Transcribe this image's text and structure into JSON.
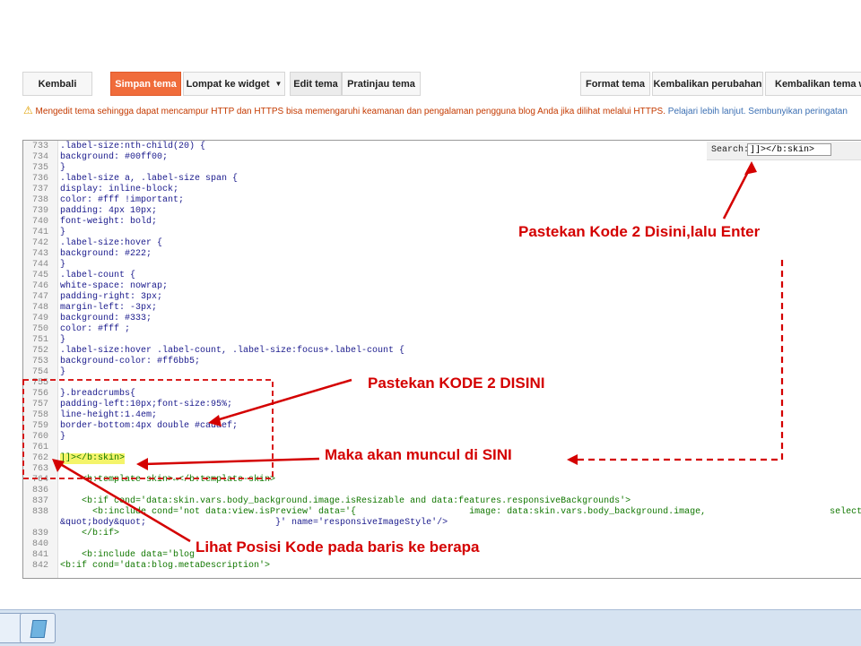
{
  "toolbar": {
    "back": "Kembali",
    "save": "Simpan tema",
    "jump": "Lompat ke widget",
    "edit": "Edit tema",
    "preview": "Pratinjau tema",
    "format": "Format tema",
    "revert": "Kembalikan perubahan",
    "restore": "Kembalikan tema wi"
  },
  "warning": {
    "text": "Mengedit tema sehingga dapat mencampur HTTP dan HTTPS bisa memengaruhi keamanan dan pengalaman pengguna blog Anda jika dilihat melalui HTTPS.",
    "learn_more": "Pelajari lebih lanjut.",
    "hide": "Sembunyikan peringatan"
  },
  "search": {
    "label": "Search:",
    "value": "]]></b:skin>"
  },
  "code_lines": [
    {
      "n": "733",
      "t": ".label-size:nth-child(20) {"
    },
    {
      "n": "734",
      "t": "background: #00ff00;"
    },
    {
      "n": "735",
      "t": "}"
    },
    {
      "n": "736",
      "t": ".label-size a, .label-size span {"
    },
    {
      "n": "737",
      "t": "display: inline-block;"
    },
    {
      "n": "738",
      "t": "color: #fff !important;"
    },
    {
      "n": "739",
      "t": "padding: 4px 10px;"
    },
    {
      "n": "740",
      "t": "font-weight: bold;"
    },
    {
      "n": "741",
      "t": "}"
    },
    {
      "n": "742",
      "t": ".label-size:hover {"
    },
    {
      "n": "743",
      "t": "background: #222;"
    },
    {
      "n": "744",
      "t": "}"
    },
    {
      "n": "745",
      "t": ".label-count {"
    },
    {
      "n": "746",
      "t": "white-space: nowrap;"
    },
    {
      "n": "747",
      "t": "padding-right: 3px;"
    },
    {
      "n": "748",
      "t": "margin-left: -3px;"
    },
    {
      "n": "749",
      "t": "background: #333;"
    },
    {
      "n": "750",
      "t": "color: #fff ;"
    },
    {
      "n": "751",
      "t": "}"
    },
    {
      "n": "752",
      "t": ".label-size:hover .label-count, .label-size:focus+.label-count {"
    },
    {
      "n": "753",
      "t": "background-color: #ff6bb5;"
    },
    {
      "n": "754",
      "t": "}"
    },
    {
      "n": "755",
      "t": ""
    },
    {
      "n": "756",
      "t": "}.breadcrumbs{"
    },
    {
      "n": "757",
      "t": "padding-left:10px;font-size:95%;"
    },
    {
      "n": "758",
      "t": "line-height:1.4em;"
    },
    {
      "n": "759",
      "t": "border-bottom:4px double #cadaef;"
    },
    {
      "n": "760",
      "t": "}"
    },
    {
      "n": "761",
      "t": ""
    },
    {
      "n": "762",
      "t": "]]></b:skin>"
    },
    {
      "n": "763",
      "t": ""
    },
    {
      "n": "764",
      "t": "    <b:template-skin>↔</b:template-skin>"
    },
    {
      "n": "836",
      "t": ""
    },
    {
      "n": "837",
      "t": "    <b:if cond='data:skin.vars.body_background.image.isResizable and data:features.responsiveBackgrounds'>"
    },
    {
      "n": "838",
      "t": "      <b:include cond='not data:view.isPreview' data='{                     image: data:skin.vars.body_background.image,                       selector"
    },
    {
      "n": "",
      "t": "&quot;body&quot;                        }' name='responsiveImageStyle'/>"
    },
    {
      "n": "839",
      "t": "    </b:if>"
    },
    {
      "n": "840",
      "t": ""
    },
    {
      "n": "841",
      "t": "    <b:include data='blog"
    },
    {
      "n": "842",
      "t": "<b:if cond='data:blog.metaDescription'>"
    }
  ],
  "annotations": {
    "a1": "Pastekan Kode 2 Disini,lalu Enter",
    "a2": "Pastekan KODE 2 DISINI",
    "a3": "Maka akan muncul di SINI",
    "a4": "Lihat  Posisi Kode pada baris ke berapa"
  },
  "colors": {
    "accent": "#f06c3b",
    "annotation": "#d40000",
    "highlight": "#f4f46a",
    "warning": "#c43a00"
  }
}
